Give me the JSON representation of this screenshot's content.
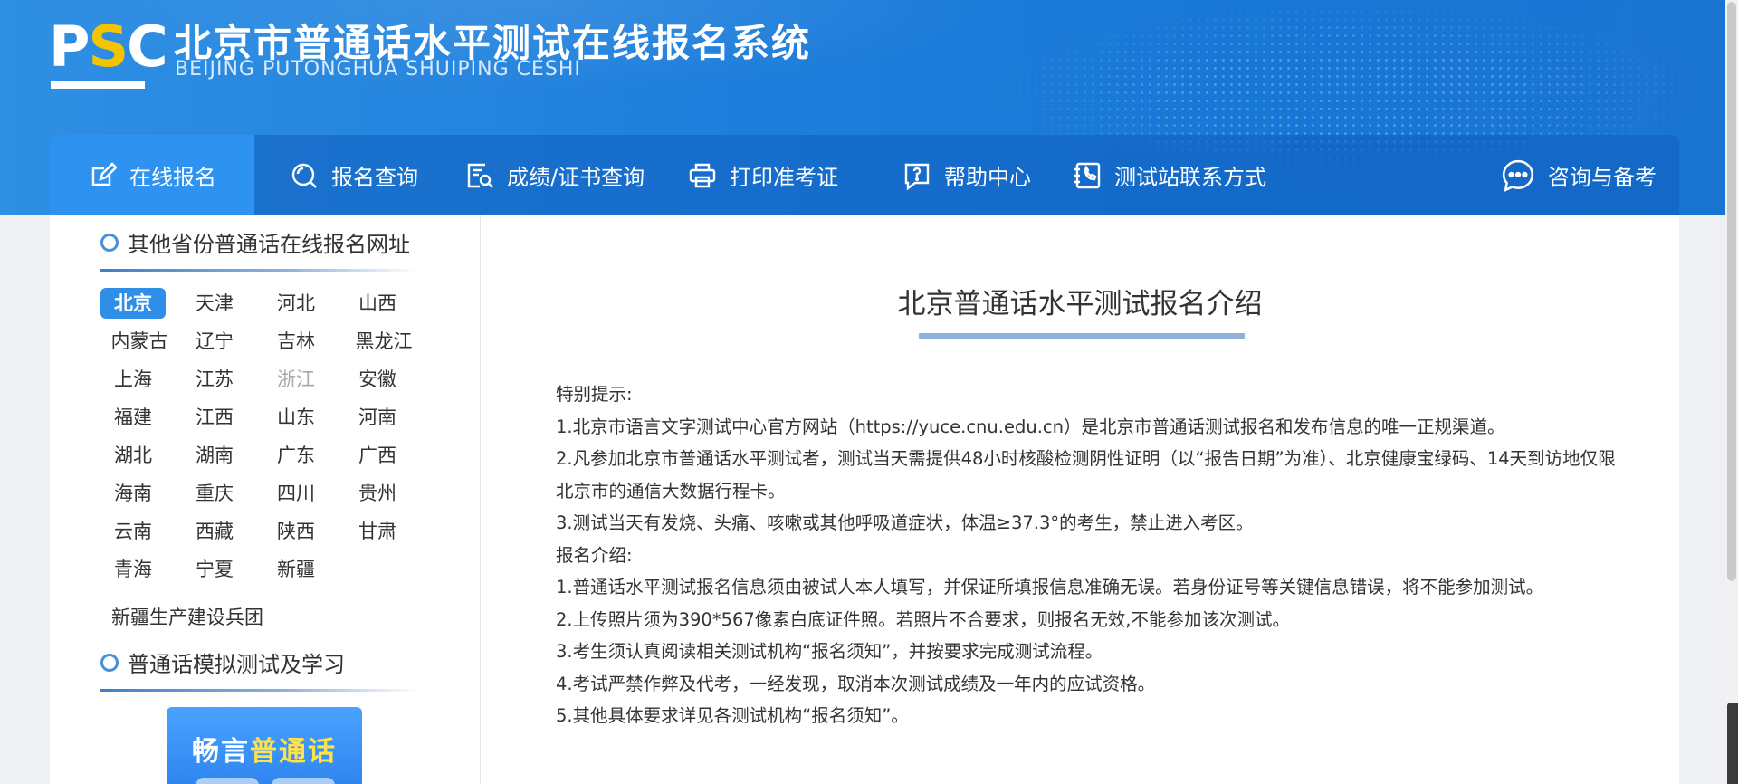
{
  "header": {
    "logo_text": "PSC",
    "title_cn": "北京市普通话水平测试在线报名系统",
    "title_en": "BEIJING PUTONGHUA SHUIPING CESHI"
  },
  "nav": [
    {
      "label": "在线报名",
      "icon": "edit-icon",
      "active": true
    },
    {
      "label": "报名查询",
      "icon": "search-icon"
    },
    {
      "label": "成绩/证书查询",
      "icon": "certificate-search-icon"
    },
    {
      "label": "打印准考证",
      "icon": "printer-icon"
    },
    {
      "label": "帮助中心",
      "icon": "help-icon"
    },
    {
      "label": "测试站联系方式",
      "icon": "phone-book-icon"
    },
    {
      "label": "咨询与备考",
      "icon": "chat-icon"
    }
  ],
  "sidebar": {
    "section1_title": "其他省份普通话在线报名网址",
    "provinces": [
      "北京",
      "天津",
      "河北",
      "山西",
      "内蒙古",
      "辽宁",
      "吉林",
      "黑龙江",
      "上海",
      "江苏",
      "浙江",
      "安徽",
      "福建",
      "江西",
      "山东",
      "河南",
      "湖北",
      "湖南",
      "广东",
      "广西",
      "海南",
      "重庆",
      "四川",
      "贵州",
      "云南",
      "西藏",
      "陕西",
      "甘肃",
      "青海",
      "宁夏",
      "新疆"
    ],
    "active_province": "北京",
    "disabled_province": "浙江",
    "extra_item": "新疆生产建设兵团",
    "section2_title": "普通话模拟测试及学习",
    "promo": {
      "part1": "畅言",
      "part2": "普通话"
    }
  },
  "main": {
    "title": "北京普通话水平测试报名介绍",
    "paragraphs": [
      "特别提示:",
      "1.北京市语言文字测试中心官方网站（https://yuce.cnu.edu.cn）是北京市普通话测试报名和发布信息的唯一正规渠道。",
      "2.凡参加北京市普通话水平测试者，测试当天需提供48小时核酸检测阴性证明（以“报告日期”为准）、北京健康宝绿码、14天到访地仅限北京市的通信大数据行程卡。",
      "3.测试当天有发烧、头痛、咳嗽或其他呼吸道症状，体温≥37.3°的考生，禁止进入考区。",
      "报名介绍:",
      "1.普通话水平测试报名信息须由被试人本人填写，并保证所填报信息准确无误。若身份证号等关键信息错误，将不能参加测试。",
      "2.上传照片须为390*567像素白底证件照。若照片不合要求，则报名无效,不能参加该次测试。",
      "3.考生须认真阅读相关测试机构“报名须知”，并按要求完成测试流程。",
      "4.考试严禁作弊及代考，一经发现，取消本次测试成绩及一年内的应试资格。",
      "5.其他具体要求详见各测试机构“报名须知”。"
    ]
  },
  "colors": {
    "header_blue": "#1f7fdc",
    "nav_active": "#2e93f0",
    "province_active": "#2f8fe8",
    "logo_accent": "#f5c400"
  }
}
